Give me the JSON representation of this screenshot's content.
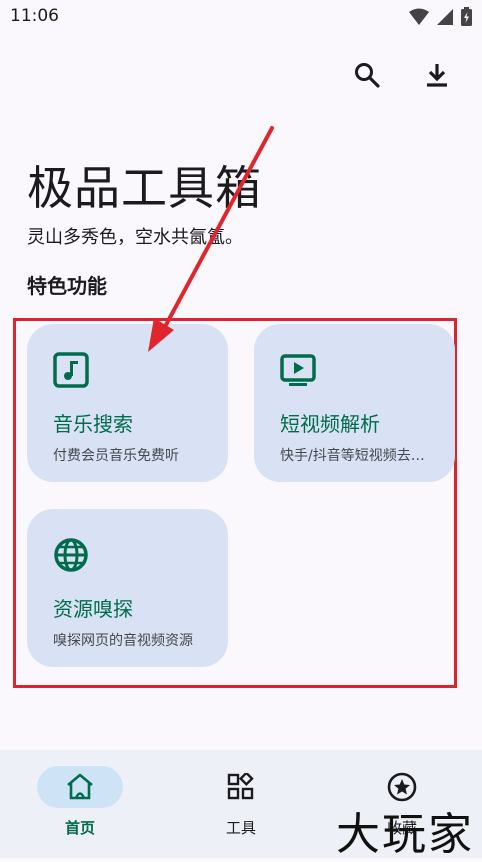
{
  "status_bar": {
    "time": "11:06"
  },
  "header": {
    "title": "极品工具箱",
    "subtitle": "灵山多秀色，空水共氤氲。",
    "section_title": "特色功能"
  },
  "cards": [
    {
      "title": "音乐搜索",
      "desc": "付费会员音乐免费听",
      "icon": "music-note-icon"
    },
    {
      "title": "短视频解析",
      "desc": "快手/抖音等短视频去水印",
      "icon": "video-play-icon"
    },
    {
      "title": "资源嗅探",
      "desc": "嗅探网页的音视频资源",
      "icon": "globe-icon"
    }
  ],
  "bottom_nav": [
    {
      "label": "首页",
      "icon": "home-icon",
      "active": true
    },
    {
      "label": "工具",
      "icon": "apps-icon",
      "active": false
    },
    {
      "label": "收藏",
      "icon": "star-icon",
      "active": false
    }
  ],
  "watermark": "大玩家",
  "colors": {
    "accent": "#006c4c",
    "card_bg": "#d9e2f4",
    "highlight": "#d8262c",
    "nav_bg": "#eef0f7"
  }
}
